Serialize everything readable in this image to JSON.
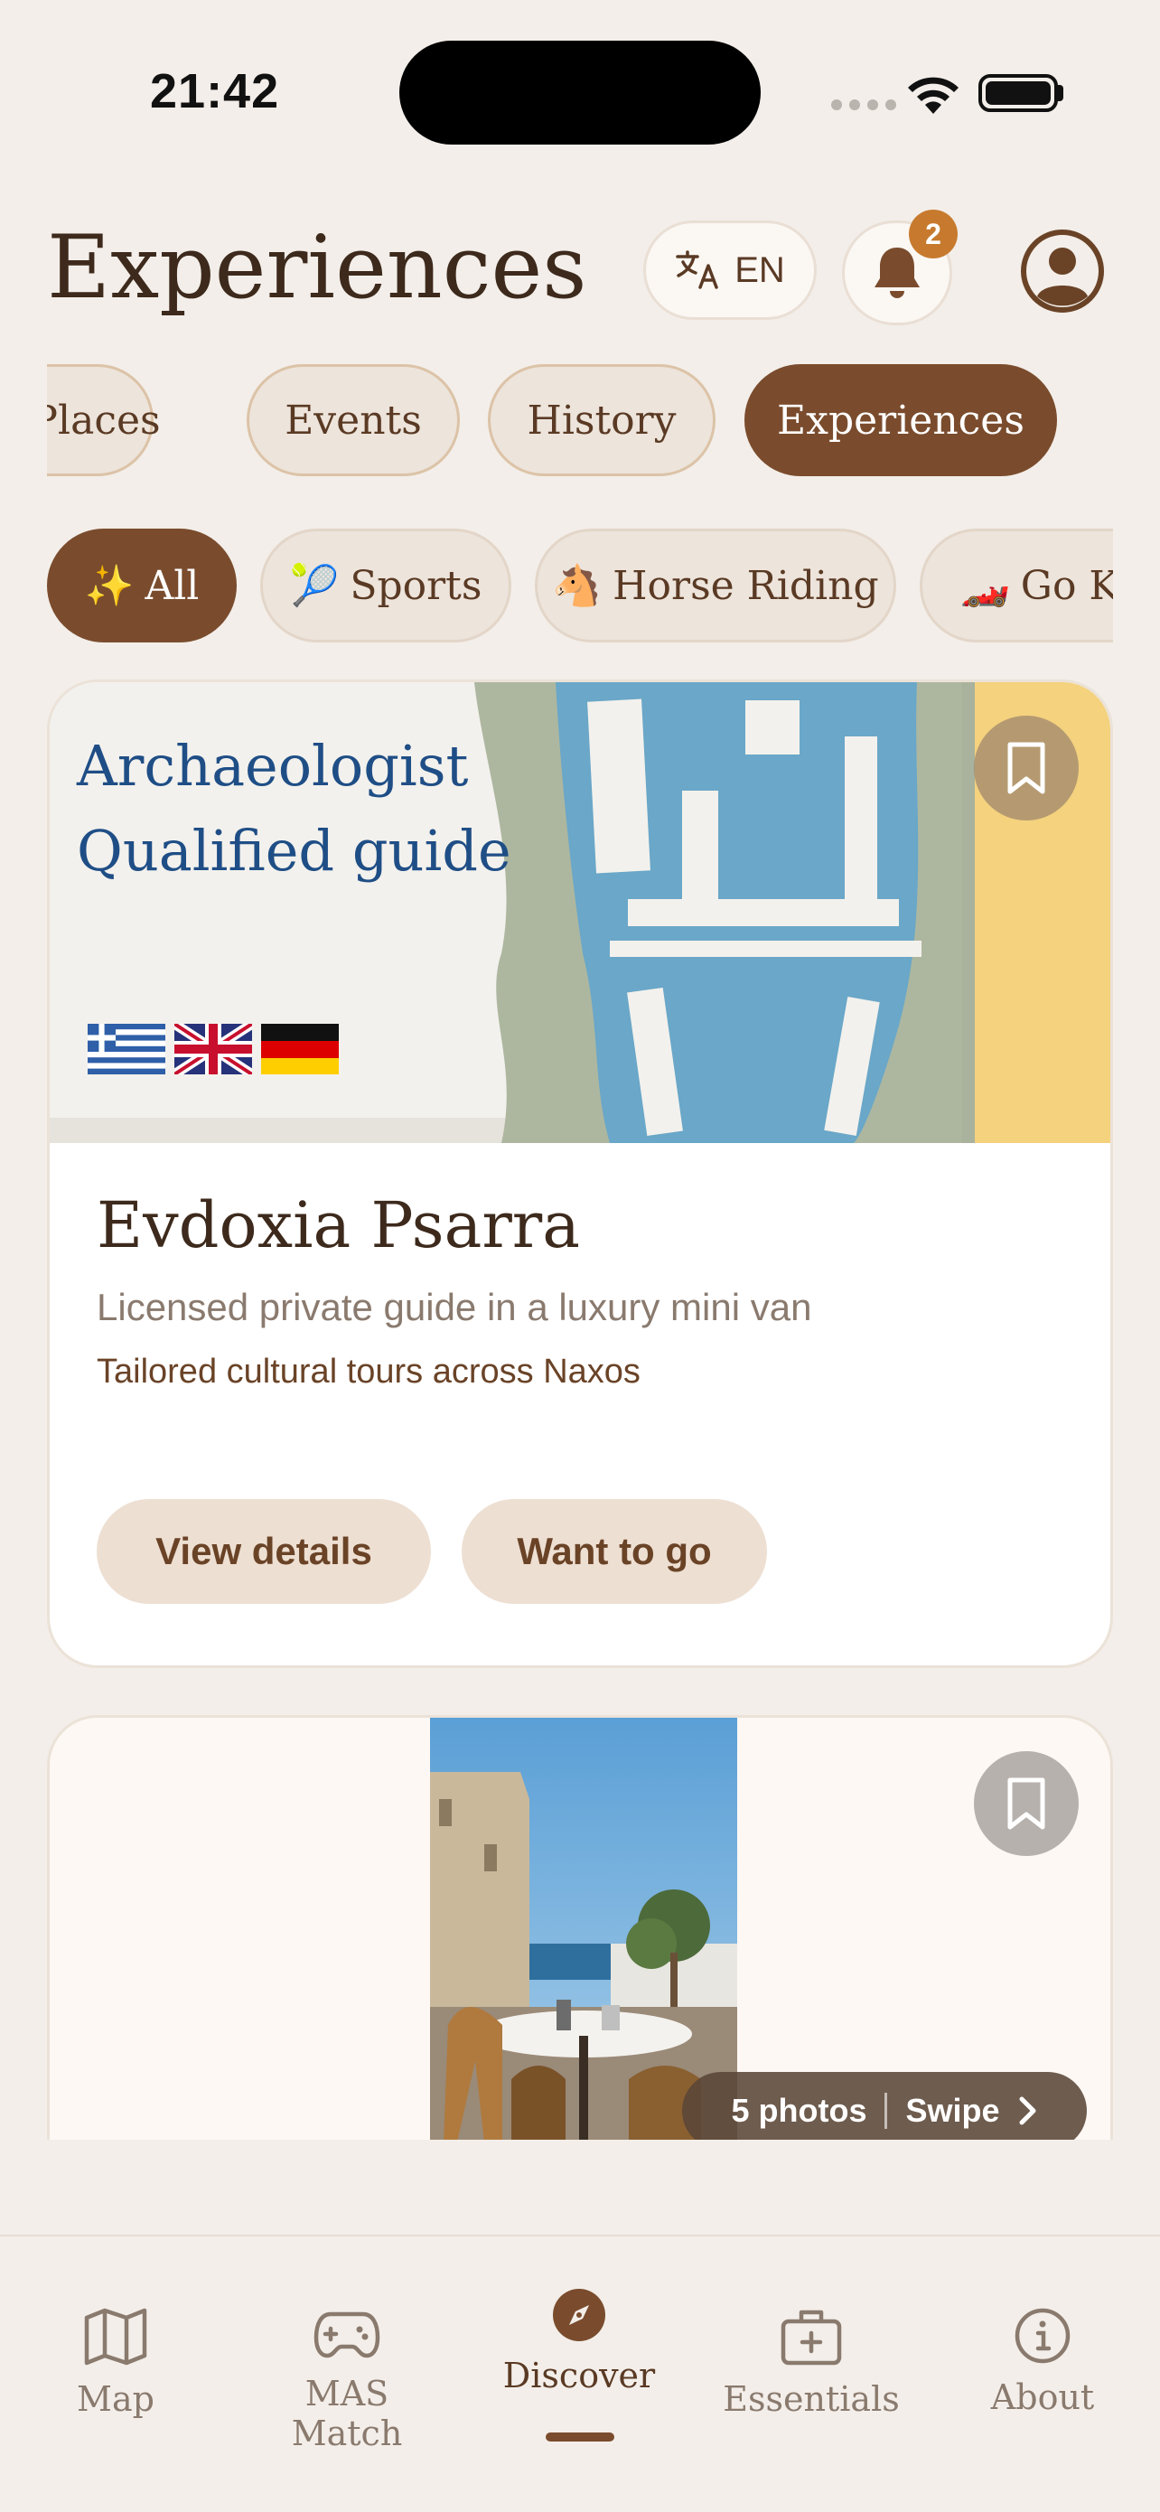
{
  "status_bar": {
    "time": "21:42"
  },
  "header": {
    "title": "Experiences",
    "language": "EN",
    "notification_count": "2"
  },
  "category_tabs": [
    {
      "label": "Places",
      "active": false
    },
    {
      "label": "Events",
      "active": false
    },
    {
      "label": "History",
      "active": false
    },
    {
      "label": "Experiences",
      "active": true
    }
  ],
  "filter_chips": [
    {
      "emoji": "✨",
      "label": "All",
      "active": true
    },
    {
      "emoji": "🎾",
      "label": "Sports",
      "active": false
    },
    {
      "emoji": "🐴",
      "label": "Horse Riding",
      "active": false
    },
    {
      "emoji": "🏎️",
      "label": "Go Karting",
      "active": false
    }
  ],
  "card1": {
    "hero_text_line1": "Archaeologist",
    "hero_text_line2": "Qualified guide",
    "name": "Evdoxia Psarra",
    "subtitle": "Licensed private guide in a luxury mini van",
    "tagline": "Tailored cultural tours across Naxos",
    "view_details_label": "View details",
    "want_to_go_label": "Want to go"
  },
  "card2": {
    "photos_label": "5 photos",
    "swipe_label": "Swipe"
  },
  "bottom_nav": [
    {
      "label": "Map",
      "icon": "map-icon",
      "active": false
    },
    {
      "label": "MAS Match",
      "icon": "gamepad-icon",
      "active": false
    },
    {
      "label": "Discover",
      "icon": "compass-icon",
      "active": true
    },
    {
      "label": "Essentials",
      "icon": "first-aid-kit-icon",
      "active": false
    },
    {
      "label": "About",
      "icon": "info-icon",
      "active": false
    }
  ],
  "colors": {
    "background": "#f3eee9",
    "accent_brown": "#7a4c2d",
    "badge_orange": "#c77a2e",
    "chip_bg": "#ede4db"
  }
}
